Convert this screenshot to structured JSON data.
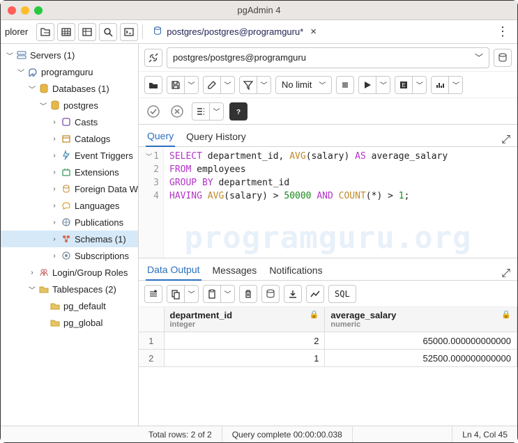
{
  "window": {
    "title": "pgAdmin 4"
  },
  "topbar": {
    "panel_label": "plorer"
  },
  "tab": {
    "label": "postgres/postgres@programguru*",
    "connection": "postgres/postgres@programguru"
  },
  "tree": {
    "l0": {
      "label": "Servers (1)"
    },
    "l1": {
      "label": "programguru"
    },
    "l2a": {
      "label": "Databases (1)"
    },
    "l3a": {
      "label": "postgres"
    },
    "l4a": {
      "label": "Casts"
    },
    "l4b": {
      "label": "Catalogs"
    },
    "l4c": {
      "label": "Event Triggers"
    },
    "l4d": {
      "label": "Extensions"
    },
    "l4e": {
      "label": "Foreign Data W"
    },
    "l4f": {
      "label": "Languages"
    },
    "l4g": {
      "label": "Publications"
    },
    "l4h": {
      "label": "Schemas (1)"
    },
    "l4i": {
      "label": "Subscriptions"
    },
    "l2b": {
      "label": "Login/Group Roles"
    },
    "l2c": {
      "label": "Tablespaces (2)"
    },
    "l3b": {
      "label": "pg_default"
    },
    "l3c": {
      "label": "pg_global"
    }
  },
  "toolbar": {
    "limit": "No limit"
  },
  "query_tabs": {
    "query": "Query",
    "history": "Query History"
  },
  "sql": {
    "line1": {
      "g1": "1",
      "kw_select": "SELECT",
      "id1": " department_id, ",
      "fn_avg": "AVG",
      "paren1": "(salary) ",
      "kw_as": "AS",
      "id2": " average_salary"
    },
    "line2": {
      "g2": "2",
      "kw_from": "FROM",
      "id": " employees"
    },
    "line3": {
      "g3": "3",
      "kw_group": "GROUP BY",
      "id": " department_id"
    },
    "line4": {
      "g4": "4",
      "kw_having": "HAVING",
      "sp": " ",
      "fn_avg": "AVG",
      "paren": "(salary) > ",
      "num1": "50000",
      "sp2": " ",
      "kw_and": "AND",
      "sp3": " ",
      "fn_count": "COUNT",
      "paren2": "(*) > ",
      "num2": "1",
      "semi": ";"
    }
  },
  "watermark": "programguru.org",
  "output_tabs": {
    "data": "Data Output",
    "messages": "Messages",
    "notifications": "Notifications"
  },
  "out_tools": {
    "sql": "SQL"
  },
  "grid": {
    "col1": {
      "name": "department_id",
      "type": "integer"
    },
    "col2": {
      "name": "average_salary",
      "type": "numeric"
    },
    "rows": [
      {
        "n": "1",
        "c1": "2",
        "c2": "65000.000000000000"
      },
      {
        "n": "2",
        "c1": "1",
        "c2": "52500.000000000000"
      }
    ]
  },
  "status": {
    "rows": "Total rows: 2 of 2",
    "time": "Query complete 00:00:00.038",
    "pos": "Ln 4, Col 45"
  }
}
